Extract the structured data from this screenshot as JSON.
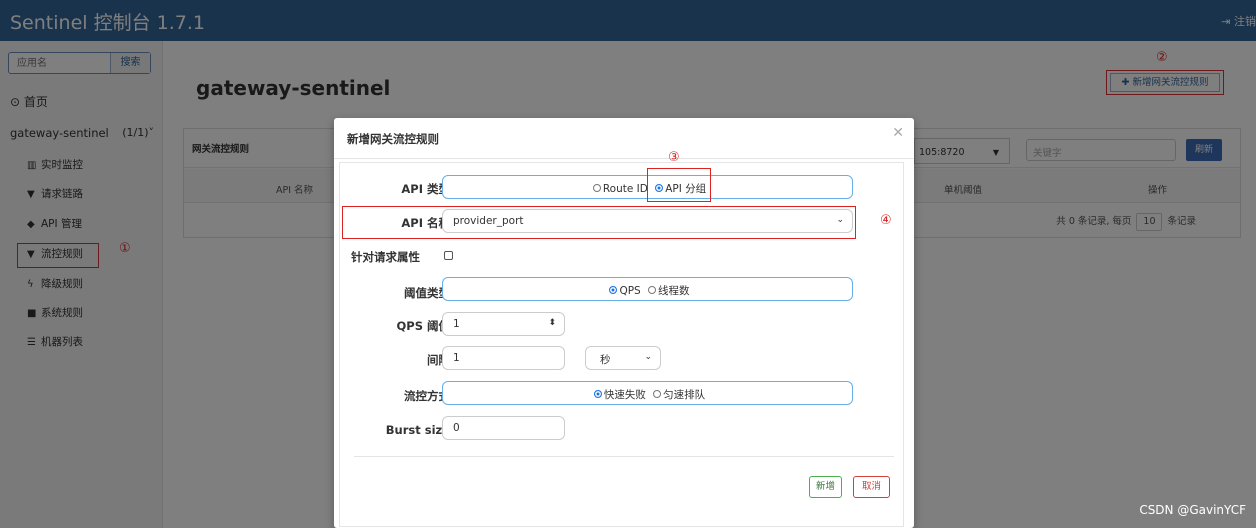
{
  "header": {
    "brand": "Sentinel 控制台 1.7.1",
    "logout": "注销"
  },
  "sidebar": {
    "search_placeholder": "应用名",
    "search_button": "搜索",
    "home": "首页",
    "app_name": "gateway-sentinel",
    "app_count": "(1/1)",
    "items": [
      {
        "icon": "chart-icon",
        "label": "实时监控"
      },
      {
        "icon": "filter-icon",
        "label": "请求链路"
      },
      {
        "icon": "tag-icon",
        "label": "API 管理"
      },
      {
        "icon": "filter-icon",
        "label": "流控规则"
      },
      {
        "icon": "bolt-icon",
        "label": "降级规则"
      },
      {
        "icon": "lock-icon",
        "label": "系统规则"
      },
      {
        "icon": "list-icon",
        "label": "机器列表"
      }
    ]
  },
  "main": {
    "title": "gateway-sentinel",
    "add_button": "新增网关流控规则",
    "panel_title": "网关流控规则",
    "machine": "105:8720",
    "keyword_placeholder": "关键字",
    "refresh": "刷新",
    "columns": [
      "API 名称",
      "单机阈值",
      "操作"
    ],
    "pager": {
      "prefix": "共 0 条记录, 每页",
      "size": "10",
      "suffix": "条记录"
    }
  },
  "modal": {
    "title": "新增网关流控规则",
    "api_type": {
      "label": "API 类型",
      "opt1": "Route ID",
      "opt2": "API 分组"
    },
    "api_name": {
      "label": "API 名称",
      "value": "provider_port"
    },
    "req_attr": {
      "label": "针对请求属性"
    },
    "threshold_type": {
      "label": "阈值类型",
      "opt1": "QPS",
      "opt2": "线程数"
    },
    "qps": {
      "label": "QPS 阈值",
      "value": "1"
    },
    "interval": {
      "label": "间隔",
      "value": "1",
      "unit": "秒"
    },
    "control": {
      "label": "流控方式",
      "opt1": "快速失败",
      "opt2": "匀速排队"
    },
    "burst": {
      "label": "Burst size",
      "value": "0"
    },
    "ok": "新增",
    "cancel": "取消"
  },
  "annotations": {
    "n1": "①",
    "n2": "②",
    "n3": "③",
    "n4": "④"
  },
  "watermark": "CSDN @GavinYCF"
}
